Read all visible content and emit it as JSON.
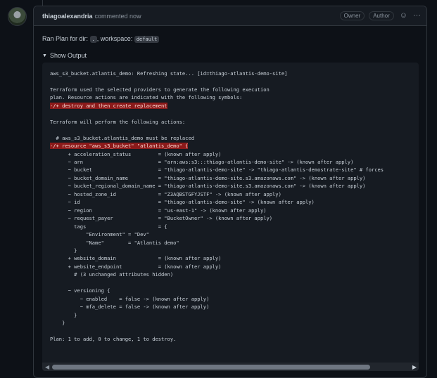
{
  "comment": {
    "author": "thiagoalexandria",
    "action": "commented now",
    "badges": [
      "Owner",
      "Author"
    ],
    "icons": [
      "smiley-icon",
      "kebab-menu-icon"
    ]
  },
  "body": {
    "ran_prefix": "Ran Plan for dir:",
    "dir_value": ".",
    "workspace_prefix": "workspace:",
    "workspace_value": "default"
  },
  "details": {
    "summary": "Show Output",
    "output_lines": [
      "aws_s3_bucket.atlantis_demo: Refreshing state... [id=thiago-atlantis-demo-site]",
      "",
      "Terraform used the selected providers to generate the following execution",
      "plan. Resource actions are indicated with the following symbols:",
      {
        "hl": "-/+ destroy and then create replacement"
      },
      "",
      "Terraform will perform the following actions:",
      "",
      "  # aws_s3_bucket.atlantis_demo must be replaced",
      {
        "hl": "-/+ resource \"aws_s3_bucket\" \"atlantis_demo\" {"
      },
      "      + acceleration_status         = (known after apply)",
      "      ~ arn                         = \"arn:aws:s3:::thiago-atlantis-demo-site\" -> (known after apply)",
      "      ~ bucket                      = \"thiago-atlantis-demo-site\" -> \"thiago-atlantis-demostrate-site\" # forces",
      "      ~ bucket_domain_name          = \"thiago-atlantis-demo-site.s3.amazonaws.com\" -> (known after apply)",
      "      ~ bucket_regional_domain_name = \"thiago-atlantis-demo-site.s3.amazonaws.com\" -> (known after apply)",
      "      ~ hosted_zone_id              = \"Z3AQBSTGFYJSTF\" -> (known after apply)",
      "      ~ id                          = \"thiago-atlantis-demo-site\" -> (known after apply)",
      "      ~ region                      = \"us-east-1\" -> (known after apply)",
      "      ~ request_payer               = \"BucketOwner\" -> (known after apply)",
      "        tags                        = {",
      "            \"Environment\" = \"Dev\"",
      "            \"Name\"        = \"Atlantis demo\"",
      "        }",
      "      + website_domain              = (known after apply)",
      "      + website_endpoint            = (known after apply)",
      "        # (3 unchanged attributes hidden)",
      "",
      "      ~ versioning {",
      "          ~ enabled    = false -> (known after apply)",
      "          ~ mfa_delete = false -> (known after apply)",
      "        }",
      "    }",
      "",
      "Plan: 1 to add, 0 to change, 1 to destroy."
    ]
  }
}
